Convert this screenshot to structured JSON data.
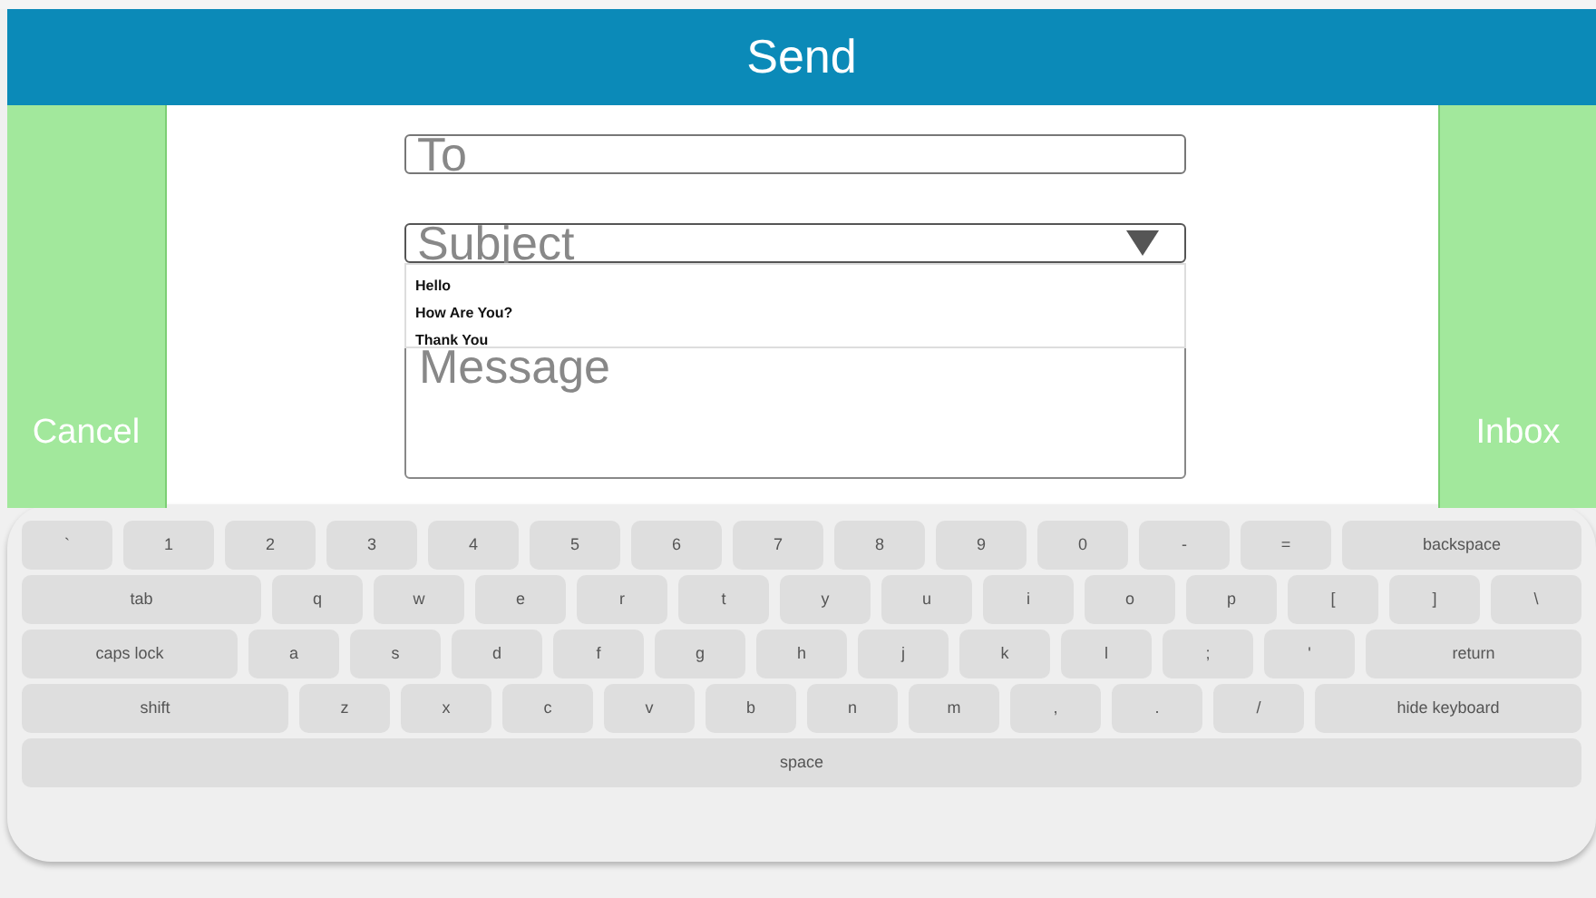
{
  "title": "Send",
  "left_button": "Cancel",
  "right_button": "Inbox",
  "to_field": {
    "placeholder": "To"
  },
  "subject_field": {
    "placeholder": "Subject",
    "expanded": true,
    "options": [
      "Hello",
      "How Are You?",
      "Thank You"
    ]
  },
  "message_field": {
    "placeholder": "Message"
  },
  "keyboard": [
    [
      {
        "label": "`",
        "kind": "key"
      },
      {
        "label": "1",
        "kind": "key"
      },
      {
        "label": "2",
        "kind": "key"
      },
      {
        "label": "3",
        "kind": "key"
      },
      {
        "label": "4",
        "kind": "key"
      },
      {
        "label": "5",
        "kind": "key"
      },
      {
        "label": "6",
        "kind": "key"
      },
      {
        "label": "7",
        "kind": "key"
      },
      {
        "label": "8",
        "kind": "key"
      },
      {
        "label": "9",
        "kind": "key"
      },
      {
        "label": "0",
        "kind": "key"
      },
      {
        "label": "-",
        "kind": "key"
      },
      {
        "label": "=",
        "kind": "key"
      },
      {
        "label": "backspace",
        "kind": "wide"
      }
    ],
    [
      {
        "label": "tab",
        "kind": "wide"
      },
      {
        "label": "q",
        "kind": "key"
      },
      {
        "label": "w",
        "kind": "key"
      },
      {
        "label": "e",
        "kind": "key"
      },
      {
        "label": "r",
        "kind": "key"
      },
      {
        "label": "t",
        "kind": "key"
      },
      {
        "label": "y",
        "kind": "key"
      },
      {
        "label": "u",
        "kind": "key"
      },
      {
        "label": "i",
        "kind": "key"
      },
      {
        "label": "o",
        "kind": "key"
      },
      {
        "label": "p",
        "kind": "key"
      },
      {
        "label": "[",
        "kind": "key"
      },
      {
        "label": "]",
        "kind": "key"
      },
      {
        "label": "\\",
        "kind": "key"
      }
    ],
    [
      {
        "label": "caps lock",
        "kind": "wide"
      },
      {
        "label": "a",
        "kind": "key"
      },
      {
        "label": "s",
        "kind": "key"
      },
      {
        "label": "d",
        "kind": "key"
      },
      {
        "label": "f",
        "kind": "key"
      },
      {
        "label": "g",
        "kind": "key"
      },
      {
        "label": "h",
        "kind": "key"
      },
      {
        "label": "j",
        "kind": "key"
      },
      {
        "label": "k",
        "kind": "key"
      },
      {
        "label": "l",
        "kind": "key"
      },
      {
        "label": ";",
        "kind": "key"
      },
      {
        "label": "'",
        "kind": "key"
      },
      {
        "label": "return",
        "kind": "wide"
      }
    ],
    [
      {
        "label": "shift",
        "kind": "wide"
      },
      {
        "label": "z",
        "kind": "key"
      },
      {
        "label": "x",
        "kind": "key"
      },
      {
        "label": "c",
        "kind": "key"
      },
      {
        "label": "v",
        "kind": "key"
      },
      {
        "label": "b",
        "kind": "key"
      },
      {
        "label": "n",
        "kind": "key"
      },
      {
        "label": "m",
        "kind": "key"
      },
      {
        "label": ",",
        "kind": "key"
      },
      {
        "label": ".",
        "kind": "key"
      },
      {
        "label": "/",
        "kind": "key"
      },
      {
        "label": "hide keyboard",
        "kind": "wide"
      }
    ],
    [
      {
        "label": "space",
        "kind": "wide"
      }
    ]
  ]
}
